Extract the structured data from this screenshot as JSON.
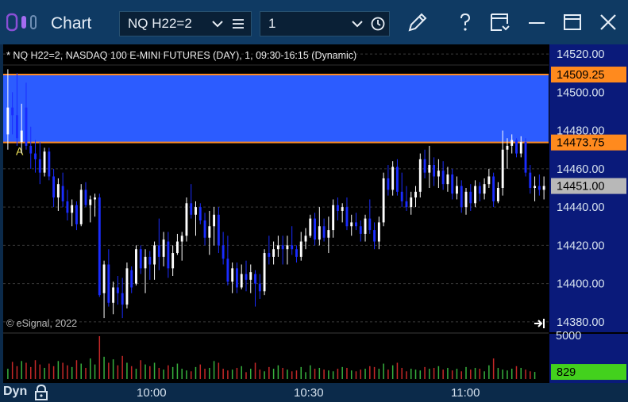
{
  "window": {
    "title": "Chart",
    "symbol": "NQ H22=2",
    "interval": "1",
    "close_symbol": "✕"
  },
  "chart": {
    "header": "* NQ H22=2, NASDAQ 100 E-MINI FUTURES (DAY), 1, 09:30-16:15 (Dynamic)",
    "copyright": "© eSignal, 2022",
    "zone_label": "A",
    "price_axis_labels": [
      "14520.00",
      "14500.00",
      "14480.00",
      "14460.00",
      "14440.00",
      "14420.00",
      "14400.00",
      "14380.00"
    ],
    "price_markers": [
      "14509.25",
      "14473.75",
      "14451.00"
    ],
    "volume_axis_labels": [
      "5000",
      "829"
    ],
    "time_labels": [
      "10:00",
      "10:30",
      "11:00"
    ],
    "footer_label": "Dyn",
    "colors": {
      "zone_fill": "#2c5cff",
      "zone_border": "#ff8c26",
      "up_candle": "#ffffff",
      "down_candle": "#1a2cff",
      "price_axis_bg": "#0a1a7a",
      "volume_up": "#37b13e",
      "volume_down": "#c62828",
      "last_volume_marker": "#43d11d"
    }
  },
  "chart_data": {
    "type": "candlestick",
    "x_labels": [
      "10:00",
      "10:30",
      "11:00"
    ],
    "ylim": [
      14375,
      14525
    ],
    "y_ticks": [
      14520,
      14500,
      14480,
      14460,
      14440,
      14420,
      14400,
      14380
    ],
    "zone": {
      "top": 14509.25,
      "bottom": 14473.75,
      "label": "A"
    },
    "last_price": 14451.0,
    "volume_ylim": [
      0,
      5000
    ],
    "last_volume": 829,
    "candles": [
      [
        14478,
        14512,
        14470,
        14492
      ],
      [
        14492,
        14500,
        14478,
        14488
      ],
      [
        14488,
        14510,
        14472,
        14476
      ],
      [
        14474,
        14494,
        14468,
        14480
      ],
      [
        14492,
        14505,
        14470,
        14472
      ],
      [
        14472,
        14482,
        14460,
        14468
      ],
      [
        14468,
        14475,
        14458,
        14465
      ],
      [
        14465,
        14474,
        14452,
        14458
      ],
      [
        14458,
        14471,
        14456,
        14469
      ],
      [
        14469,
        14471,
        14454,
        14456
      ],
      [
        14456,
        14460,
        14440,
        14445
      ],
      [
        14445,
        14455,
        14438,
        14452
      ],
      [
        14451,
        14458,
        14440,
        14443
      ],
      [
        14443,
        14449,
        14433,
        14437
      ],
      [
        14437,
        14444,
        14430,
        14441
      ],
      [
        14441,
        14443,
        14428,
        14431
      ],
      [
        14431,
        14452,
        14430,
        14449
      ],
      [
        14449,
        14453,
        14440,
        14441
      ],
      [
        14441,
        14446,
        14432,
        14444
      ],
      [
        14444,
        14447,
        14435,
        14445
      ],
      [
        14445,
        14447,
        14393,
        14394
      ],
      [
        14395,
        14412,
        14382,
        14410
      ],
      [
        14410,
        14418,
        14388,
        14390
      ],
      [
        14390,
        14401,
        14384,
        14398
      ],
      [
        14398,
        14404,
        14389,
        14395
      ],
      [
        14395,
        14403,
        14382,
        14389
      ],
      [
        14389,
        14411,
        14387,
        14408
      ],
      [
        14407,
        14409,
        14395,
        14398
      ],
      [
        14400,
        14420,
        14399,
        14418
      ],
      [
        14418,
        14420,
        14405,
        14408
      ],
      [
        14408,
        14418,
        14395,
        14414
      ],
      [
        14414,
        14417,
        14402,
        14410
      ],
      [
        14410,
        14422,
        14402,
        14420
      ],
      [
        14420,
        14434,
        14407,
        14414
      ],
      [
        14414,
        14427,
        14409,
        14423
      ],
      [
        14422,
        14427,
        14403,
        14408
      ],
      [
        14408,
        14420,
        14404,
        14416
      ],
      [
        14416,
        14426,
        14415,
        14422
      ],
      [
        14422,
        14427,
        14412,
        14425
      ],
      [
        14425,
        14445,
        14422,
        14442
      ],
      [
        14442,
        14452,
        14434,
        14436
      ],
      [
        14436,
        14443,
        14425,
        14440
      ],
      [
        14440,
        14442,
        14431,
        14433
      ],
      [
        14433,
        14437,
        14420,
        14424
      ],
      [
        14424,
        14438,
        14415,
        14430
      ],
      [
        14430,
        14440,
        14420,
        14436
      ],
      [
        14436,
        14440,
        14416,
        14420
      ],
      [
        14420,
        14427,
        14410,
        14413
      ],
      [
        14413,
        14425,
        14399,
        14401
      ],
      [
        14401,
        14411,
        14395,
        14408
      ],
      [
        14408,
        14411,
        14395,
        14398
      ],
      [
        14398,
        14410,
        14397,
        14405
      ],
      [
        14405,
        14412,
        14396,
        14402
      ],
      [
        14402,
        14410,
        14395,
        14406
      ],
      [
        14405,
        14407,
        14388,
        14400
      ],
      [
        14400,
        14405,
        14392,
        14396
      ],
      [
        14396,
        14418,
        14394,
        14416
      ],
      [
        14416,
        14425,
        14410,
        14414
      ],
      [
        14414,
        14422,
        14410,
        14418
      ],
      [
        14418,
        14425,
        14414,
        14420
      ],
      [
        14420,
        14425,
        14410,
        14418
      ],
      [
        14418,
        14425,
        14410,
        14420
      ],
      [
        14420,
        14430,
        14415,
        14418
      ],
      [
        14418,
        14420,
        14411,
        14414
      ],
      [
        14414,
        14427,
        14412,
        14422
      ],
      [
        14422,
        14429,
        14418,
        14425
      ],
      [
        14425,
        14436,
        14424,
        14434
      ],
      [
        14434,
        14437,
        14420,
        14423
      ],
      [
        14423,
        14440,
        14420,
        14430
      ],
      [
        14430,
        14434,
        14422,
        14424
      ],
      [
        14424,
        14435,
        14416,
        14428
      ],
      [
        14428,
        14444,
        14424,
        14441
      ],
      [
        14441,
        14445,
        14433,
        14438
      ],
      [
        14438,
        14442,
        14432,
        14440
      ],
      [
        14440,
        14445,
        14428,
        14430
      ],
      [
        14430,
        14436,
        14425,
        14432
      ],
      [
        14432,
        14437,
        14428,
        14430
      ],
      [
        14430,
        14433,
        14422,
        14426
      ],
      [
        14426,
        14436,
        14422,
        14434
      ],
      [
        14434,
        14444,
        14426,
        14428
      ],
      [
        14428,
        14432,
        14418,
        14422
      ],
      [
        14422,
        14435,
        14418,
        14432
      ],
      [
        14432,
        14458,
        14430,
        14455
      ],
      [
        14455,
        14462,
        14446,
        14449
      ],
      [
        14449,
        14464,
        14446,
        14461
      ],
      [
        14461,
        14465,
        14446,
        14448
      ],
      [
        14448,
        14458,
        14440,
        14443
      ],
      [
        14443,
        14451,
        14438,
        14440
      ],
      [
        14440,
        14448,
        14436,
        14445
      ],
      [
        14445,
        14451,
        14440,
        14448
      ],
      [
        14448,
        14468,
        14445,
        14465
      ],
      [
        14465,
        14470,
        14455,
        14458
      ],
      [
        14458,
        14472,
        14450,
        14462
      ],
      [
        14462,
        14466,
        14451,
        14456
      ],
      [
        14456,
        14465,
        14450,
        14459
      ],
      [
        14459,
        14464,
        14449,
        14452
      ],
      [
        14452,
        14461,
        14448,
        14457
      ],
      [
        14457,
        14460,
        14444,
        14447
      ],
      [
        14447,
        14456,
        14444,
        14451
      ],
      [
        14451,
        14454,
        14437,
        14440
      ],
      [
        14440,
        14450,
        14436,
        14448
      ],
      [
        14448,
        14452,
        14438,
        14442
      ],
      [
        14442,
        14454,
        14440,
        14451
      ],
      [
        14451,
        14453,
        14443,
        14447
      ],
      [
        14447,
        14455,
        14444,
        14452
      ],
      [
        14452,
        14460,
        14450,
        14456
      ],
      [
        14456,
        14458,
        14440,
        14443
      ],
      [
        14443,
        14453,
        14442,
        14450
      ],
      [
        14450,
        14480,
        14446,
        14470
      ],
      [
        14470,
        14476,
        14460,
        14472
      ],
      [
        14472,
        14478,
        14468,
        14475
      ],
      [
        14475,
        14476,
        14466,
        14468
      ],
      [
        14468,
        14477,
        14466,
        14474
      ],
      [
        14474,
        14476,
        14456,
        14458
      ],
      [
        14458,
        14462,
        14447,
        14450
      ],
      [
        14450,
        14456,
        14443,
        14451
      ],
      [
        14451,
        14457,
        14446,
        14449
      ],
      [
        14449,
        14456,
        14444,
        14451
      ]
    ],
    "volumes": [
      1200,
      2000,
      1500,
      2100,
      1900,
      1400,
      2200,
      1700,
      1300,
      1800,
      1500,
      2100,
      1900,
      1600,
      1400,
      2200,
      1800,
      1300,
      2400,
      1700,
      5000,
      2600,
      1900,
      2300,
      1600,
      2700,
      1900,
      1500,
      1200,
      2200,
      1700,
      1500,
      1900,
      1300,
      1100,
      1600,
      1400,
      1800,
      1200,
      1000,
      900,
      1400,
      1700,
      1200,
      1300,
      2100,
      1900,
      1200,
      1000,
      1100,
      1300,
      1500,
      800,
      1200,
      1900,
      1100,
      900,
      1400,
      1200,
      1600,
      1300,
      1100,
      900,
      1000,
      1400,
      800,
      1600,
      1200,
      1300,
      1100,
      1000,
      900,
      1200,
      1400,
      1300,
      1000,
      900,
      1100,
      1200,
      1500,
      1400,
      1200,
      1800,
      1100,
      1600,
      1900,
      1300,
      900,
      1200,
      1100,
      1000,
      1400,
      1200,
      1300,
      1500,
      1100,
      1300,
      1000,
      1200,
      900,
      1400,
      1100,
      1300,
      1200,
      900,
      1600,
      2400,
      1300,
      1100,
      1000,
      1200,
      1500,
      1300,
      1100,
      900,
      829
    ]
  }
}
